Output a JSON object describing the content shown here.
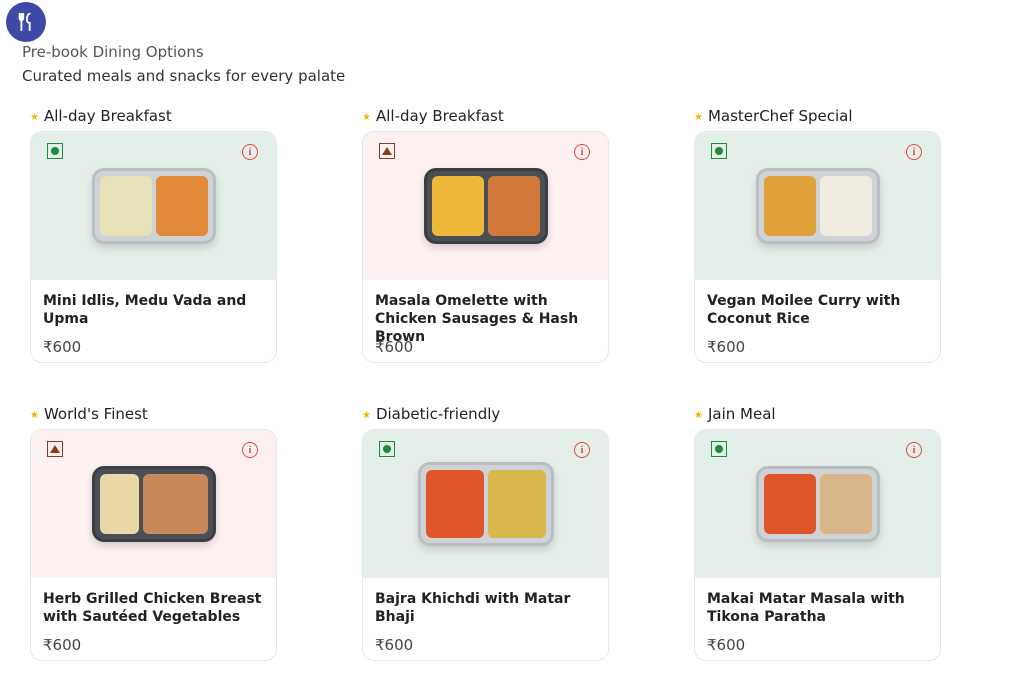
{
  "header": {
    "icon": "cutlery-icon",
    "title": "Pre-book Dining Options",
    "subtitle": "Curated meals and snacks for every palate"
  },
  "colors": {
    "accent": "#3f4aa8",
    "veg": "#1a8c3a",
    "nonveg": "#8b3a1d",
    "info": "#e0483c",
    "star": "#f4b400",
    "veg_bg": "#e5efe9",
    "nonveg_bg": "#fdf0f0"
  },
  "items": [
    {
      "tag": "All-day Breakfast",
      "diet": "veg",
      "name": "Mini Idlis, Medu Vada and Upma",
      "price": "₹600"
    },
    {
      "tag": "All-day Breakfast",
      "diet": "non-veg",
      "name": "Masala Omelette with Chicken Sausages & Hash Brown",
      "price": "₹600"
    },
    {
      "tag": "MasterChef Special",
      "diet": "veg",
      "name": "Vegan Moilee Curry with Coconut Rice",
      "price": "₹600"
    },
    {
      "tag": "World's Finest",
      "diet": "non-veg",
      "name": "Herb Grilled Chicken Breast with Sautéed Vegetables",
      "price": "₹600"
    },
    {
      "tag": "Diabetic-friendly",
      "diet": "veg",
      "name": "Bajra Khichdi with Matar Bhaji",
      "price": "₹600"
    },
    {
      "tag": "Jain Meal",
      "diet": "veg",
      "name": "Makai Matar Masala with Tikona Paratha",
      "price": "₹600"
    }
  ]
}
